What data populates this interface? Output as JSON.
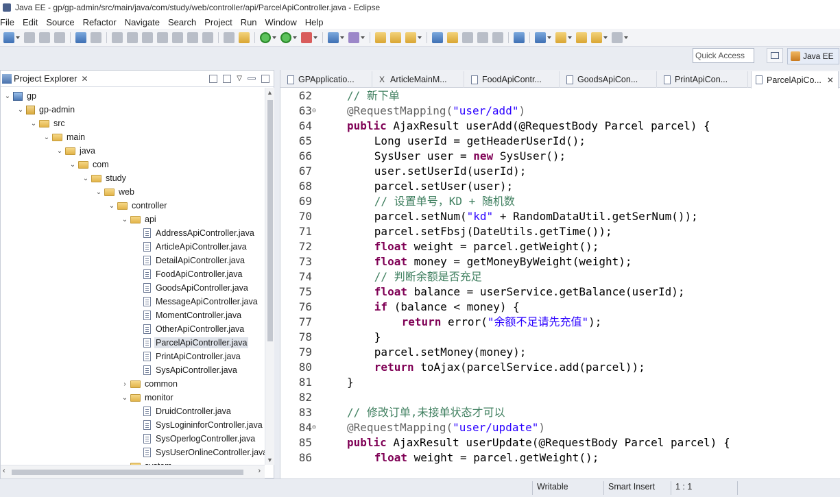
{
  "window": {
    "title": "Java EE - gp/gp-admin/src/main/java/com/study/web/controller/api/ParcelApiController.java - Eclipse"
  },
  "menu": [
    "File",
    "Edit",
    "Source",
    "Refactor",
    "Navigate",
    "Search",
    "Project",
    "Run",
    "Window",
    "Help"
  ],
  "toolbar": {
    "quick_access_placeholder": "Quick Access",
    "perspective": "Java EE"
  },
  "explorer": {
    "title": "Project Explorer",
    "tree": [
      {
        "label": "gp",
        "depth": 0,
        "kind": "project",
        "expanded": true
      },
      {
        "label": "gp-admin",
        "depth": 1,
        "kind": "project",
        "expanded": true
      },
      {
        "label": "src",
        "depth": 2,
        "kind": "folder",
        "expanded": true
      },
      {
        "label": "main",
        "depth": 3,
        "kind": "folder",
        "expanded": true
      },
      {
        "label": "java",
        "depth": 4,
        "kind": "folder",
        "expanded": true
      },
      {
        "label": "com",
        "depth": 5,
        "kind": "folder",
        "expanded": true
      },
      {
        "label": "study",
        "depth": 6,
        "kind": "folder",
        "expanded": true
      },
      {
        "label": "web",
        "depth": 7,
        "kind": "folder",
        "expanded": true
      },
      {
        "label": "controller",
        "depth": 8,
        "kind": "folder",
        "expanded": true
      },
      {
        "label": "api",
        "depth": 9,
        "kind": "folder",
        "expanded": true
      },
      {
        "label": "AddressApiController.java",
        "depth": 10,
        "kind": "java"
      },
      {
        "label": "ArticleApiController.java",
        "depth": 10,
        "kind": "java"
      },
      {
        "label": "DetailApiController.java",
        "depth": 10,
        "kind": "java"
      },
      {
        "label": "FoodApiController.java",
        "depth": 10,
        "kind": "java"
      },
      {
        "label": "GoodsApiController.java",
        "depth": 10,
        "kind": "java"
      },
      {
        "label": "MessageApiController.java",
        "depth": 10,
        "kind": "java"
      },
      {
        "label": "MomentController.java",
        "depth": 10,
        "kind": "java"
      },
      {
        "label": "OtherApiController.java",
        "depth": 10,
        "kind": "java"
      },
      {
        "label": "ParcelApiController.java",
        "depth": 10,
        "kind": "java",
        "selected": true
      },
      {
        "label": "PrintApiController.java",
        "depth": 10,
        "kind": "java"
      },
      {
        "label": "SysApiController.java",
        "depth": 10,
        "kind": "java"
      },
      {
        "label": "common",
        "depth": 9,
        "kind": "folder",
        "expanded": false
      },
      {
        "label": "monitor",
        "depth": 9,
        "kind": "folder",
        "expanded": true
      },
      {
        "label": "DruidController.java",
        "depth": 10,
        "kind": "java"
      },
      {
        "label": "SysLogininforController.java",
        "depth": 10,
        "kind": "java"
      },
      {
        "label": "SysOperlogController.java",
        "depth": 10,
        "kind": "java"
      },
      {
        "label": "SysUserOnlineController.java",
        "depth": 10,
        "kind": "java"
      },
      {
        "label": "system",
        "depth": 9,
        "kind": "folder",
        "expanded": false
      }
    ]
  },
  "editor": {
    "tabs": [
      {
        "label": "GPApplicatio...",
        "icon": "java"
      },
      {
        "label": "ArticleMainM...",
        "icon": "xml"
      },
      {
        "label": "FoodApiContr...",
        "icon": "java"
      },
      {
        "label": "GoodsApiCon...",
        "icon": "java"
      },
      {
        "label": "PrintApiCon...",
        "icon": "java"
      },
      {
        "label": "ParcelApiCo...",
        "icon": "java",
        "active": true
      }
    ],
    "lines": [
      {
        "n": "62",
        "fold": "",
        "indent": 4,
        "tokens": [
          {
            "t": "// 新下单",
            "c": "cmt"
          }
        ]
      },
      {
        "n": "63",
        "fold": "⊖",
        "indent": 4,
        "tokens": [
          {
            "t": "@RequestMapping(",
            "c": "ann"
          },
          {
            "t": "\"user/add\"",
            "c": "str"
          },
          {
            "t": ")",
            "c": "ann"
          }
        ]
      },
      {
        "n": "64",
        "fold": "",
        "indent": 4,
        "tokens": [
          {
            "t": "public",
            "c": "kw"
          },
          {
            "t": " AjaxResult userAdd(@RequestBody Parcel parcel) {",
            "c": ""
          }
        ]
      },
      {
        "n": "65",
        "fold": "",
        "indent": 8,
        "tokens": [
          {
            "t": "Long userId = getHeaderUserId();",
            "c": ""
          }
        ]
      },
      {
        "n": "66",
        "fold": "",
        "indent": 8,
        "tokens": [
          {
            "t": "SysUser user = ",
            "c": ""
          },
          {
            "t": "new",
            "c": "kw"
          },
          {
            "t": " SysUser();",
            "c": ""
          }
        ]
      },
      {
        "n": "67",
        "fold": "",
        "indent": 8,
        "tokens": [
          {
            "t": "user.setUserId(userId);",
            "c": ""
          }
        ]
      },
      {
        "n": "68",
        "fold": "",
        "indent": 8,
        "tokens": [
          {
            "t": "parcel.setUser(user);",
            "c": ""
          }
        ]
      },
      {
        "n": "69",
        "fold": "",
        "indent": 8,
        "tokens": [
          {
            "t": "// 设置单号，KD + 随机数",
            "c": "cmt"
          }
        ]
      },
      {
        "n": "70",
        "fold": "",
        "indent": 8,
        "tokens": [
          {
            "t": "parcel.setNum(",
            "c": ""
          },
          {
            "t": "\"kd\"",
            "c": "str"
          },
          {
            "t": " + RandomDataUtil.getSerNum());",
            "c": ""
          }
        ]
      },
      {
        "n": "71",
        "fold": "",
        "indent": 8,
        "tokens": [
          {
            "t": "parcel.setFbsj(DateUtils.getTime());",
            "c": ""
          }
        ]
      },
      {
        "n": "72",
        "fold": "",
        "indent": 8,
        "tokens": [
          {
            "t": "float",
            "c": "kw"
          },
          {
            "t": " weight = parcel.getWeight();",
            "c": ""
          }
        ]
      },
      {
        "n": "73",
        "fold": "",
        "indent": 8,
        "tokens": [
          {
            "t": "float",
            "c": "kw"
          },
          {
            "t": " money = getMoneyByWeight(weight);",
            "c": ""
          }
        ]
      },
      {
        "n": "74",
        "fold": "",
        "indent": 8,
        "tokens": [
          {
            "t": "// 判断余额是否充足",
            "c": "cmt"
          }
        ]
      },
      {
        "n": "75",
        "fold": "",
        "indent": 8,
        "tokens": [
          {
            "t": "float",
            "c": "kw"
          },
          {
            "t": " balance = userService.getBalance(userId);",
            "c": ""
          }
        ]
      },
      {
        "n": "76",
        "fold": "",
        "indent": 8,
        "tokens": [
          {
            "t": "if",
            "c": "kw"
          },
          {
            "t": " (balance < money) {",
            "c": ""
          }
        ]
      },
      {
        "n": "77",
        "fold": "",
        "indent": 12,
        "tokens": [
          {
            "t": "return",
            "c": "kw"
          },
          {
            "t": " error(",
            "c": ""
          },
          {
            "t": "\"余额不足请先充值\"",
            "c": "str"
          },
          {
            "t": ");",
            "c": ""
          }
        ]
      },
      {
        "n": "78",
        "fold": "",
        "indent": 8,
        "tokens": [
          {
            "t": "}",
            "c": ""
          }
        ]
      },
      {
        "n": "79",
        "fold": "",
        "indent": 8,
        "tokens": [
          {
            "t": "parcel.setMoney(money);",
            "c": ""
          }
        ]
      },
      {
        "n": "80",
        "fold": "",
        "indent": 8,
        "tokens": [
          {
            "t": "return",
            "c": "kw"
          },
          {
            "t": " toAjax(parcelService.add(parcel));",
            "c": ""
          }
        ]
      },
      {
        "n": "81",
        "fold": "",
        "indent": 4,
        "tokens": [
          {
            "t": "}",
            "c": ""
          }
        ]
      },
      {
        "n": "82",
        "fold": "",
        "indent": 0,
        "tokens": []
      },
      {
        "n": "83",
        "fold": "",
        "indent": 4,
        "tokens": [
          {
            "t": "// 修改订单,未接单状态才可以",
            "c": "cmt"
          }
        ]
      },
      {
        "n": "84",
        "fold": "⊖",
        "indent": 4,
        "tokens": [
          {
            "t": "@RequestMapping(",
            "c": "ann"
          },
          {
            "t": "\"user/update\"",
            "c": "str"
          },
          {
            "t": ")",
            "c": "ann"
          }
        ]
      },
      {
        "n": "85",
        "fold": "",
        "indent": 4,
        "tokens": [
          {
            "t": "public",
            "c": "kw"
          },
          {
            "t": " AjaxResult userUpdate(@RequestBody Parcel parcel) {",
            "c": ""
          }
        ]
      },
      {
        "n": "86",
        "fold": "",
        "indent": 8,
        "tokens": [
          {
            "t": "float",
            "c": "kw"
          },
          {
            "t": " weight = parcel.getWeight();",
            "c": ""
          }
        ]
      }
    ]
  },
  "status": {
    "writable": "Writable",
    "insert_mode": "Smart Insert",
    "position": "1 : 1"
  }
}
